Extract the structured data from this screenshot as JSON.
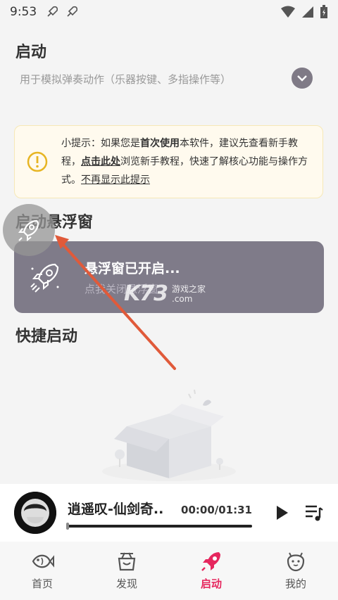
{
  "status_bar": {
    "time": "9:53"
  },
  "sections": {
    "launch_title": "启动",
    "launch_desc": "用于模拟弹奏动作（乐器按键、多指操作等）",
    "float_title": "启动悬浮窗",
    "quick_title": "快捷启动"
  },
  "tip": {
    "p1": "小提示：如果您是",
    "b1": "首次使用",
    "p2": "本软件，建议先查看新手教程，",
    "b2": "点击此处",
    "p3": "浏览新手教程，快速了解核心功能与操作方式。",
    "dismiss": "不再显示此提示"
  },
  "float_card": {
    "title": "悬浮窗已开启...",
    "subtitle": "点我关闭悬浮窗"
  },
  "watermark": {
    "brand": "K73",
    "cn": "游戏之家",
    "com": ".com"
  },
  "player": {
    "song": "逍遥叹-仙剑奇..",
    "time": "00:00/01:31",
    "progress": 0
  },
  "tabs": [
    {
      "label": "首页",
      "icon": "fish-icon"
    },
    {
      "label": "发现",
      "icon": "basket-icon"
    },
    {
      "label": "启动",
      "icon": "rocket-icon",
      "active": true
    },
    {
      "label": "我的",
      "icon": "face-icon"
    }
  ],
  "colors": {
    "accent": "#e6275e",
    "card": "#7f7b89",
    "tip_bg": "#fffaee",
    "arrow": "#e05a3a"
  }
}
